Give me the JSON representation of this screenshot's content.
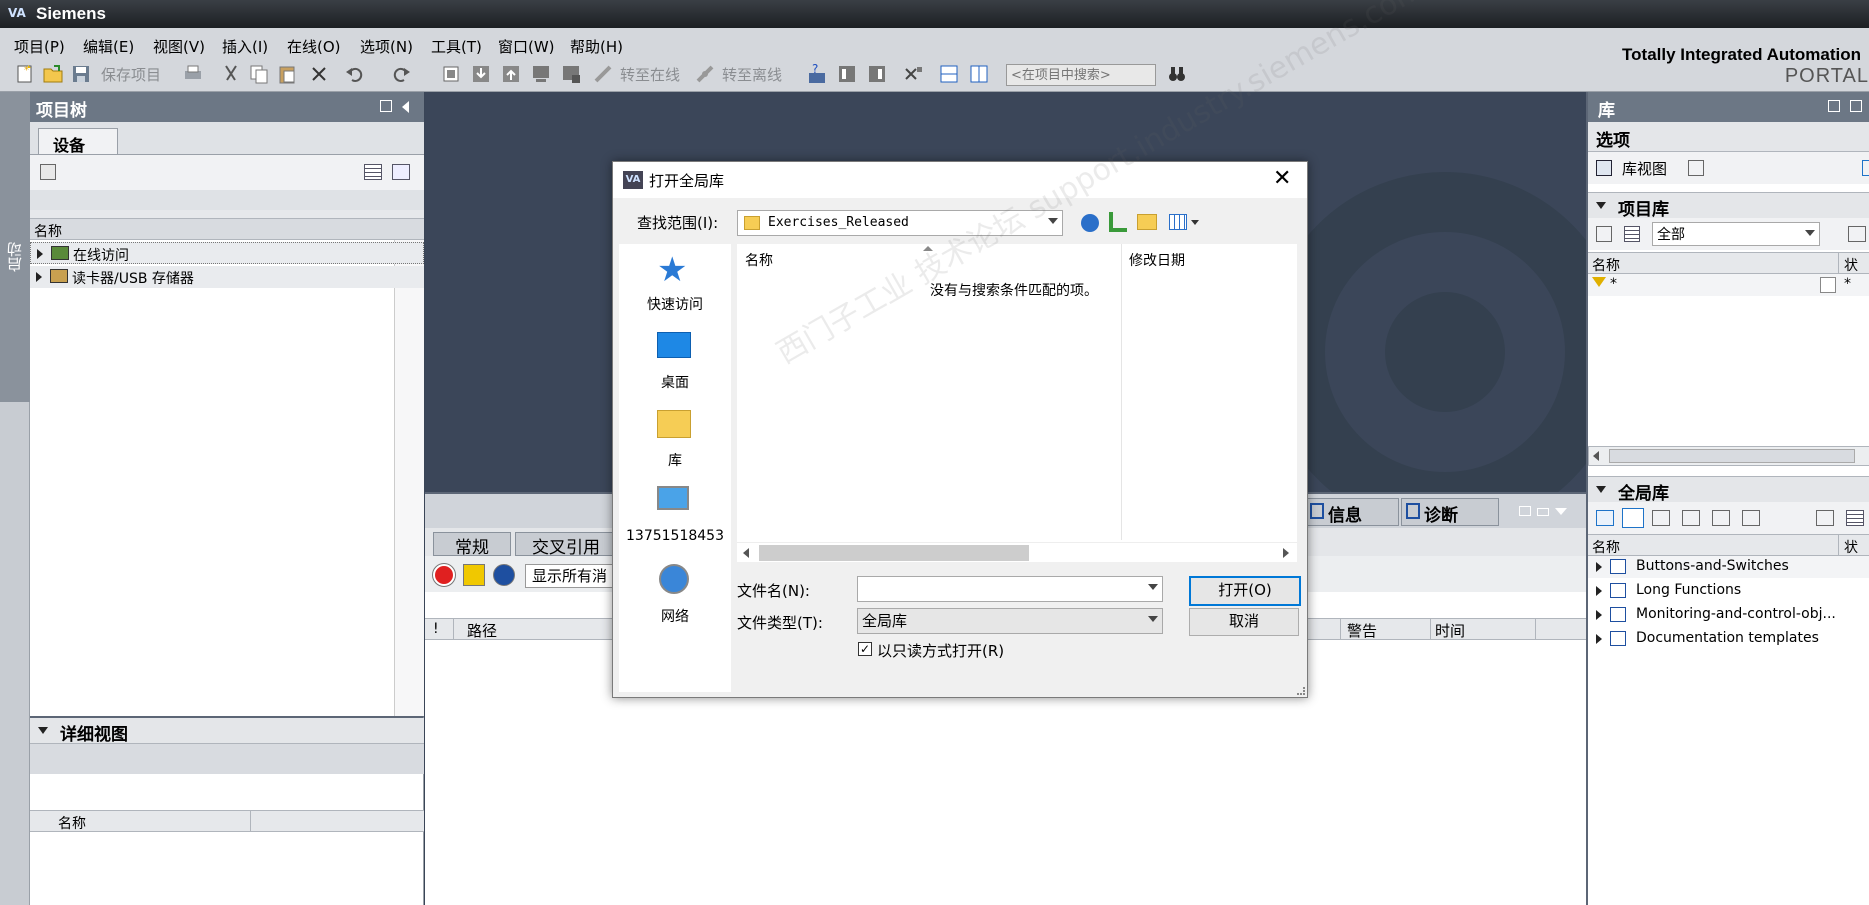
{
  "app": {
    "title": "Siemens",
    "brand_line1": "Totally Integrated Automation",
    "brand_line2": "PORTAL"
  },
  "menu": [
    "项目(P)",
    "编辑(E)",
    "视图(V)",
    "插入(I)",
    "在线(O)",
    "选项(N)",
    "工具(T)",
    "窗口(W)",
    "帮助(H)"
  ],
  "toolbar": {
    "save_project": "保存项目",
    "go_online": "转至在线",
    "go_offline": "转至离线",
    "search_placeholder": "<在项目中搜索>"
  },
  "side_strip": {
    "label": "启动"
  },
  "project_tree": {
    "title": "项目树",
    "tab": "设备",
    "column_name": "名称",
    "items": [
      {
        "label": "在线访问"
      },
      {
        "label": "读卡器/USB 存储器"
      }
    ]
  },
  "detail_view": {
    "title": "详细视图",
    "column_name": "名称"
  },
  "inspector": {
    "tabs": [
      "常规",
      "交叉引用"
    ],
    "show_all_messages": "显示所有消",
    "info_tab": "信息",
    "diag_tab": "诊断",
    "columns": [
      "!",
      "路径",
      "警告",
      "时间"
    ]
  },
  "library": {
    "title": "库",
    "options": "选项",
    "library_view": "库视图",
    "project_library": "项目库",
    "filter_value": "全部",
    "column_name": "名称",
    "column_status": "状态",
    "filter_row": "*",
    "filter_status": "*",
    "global_library": "全局库",
    "global_items": [
      "Buttons-and-Switches",
      "Long Functions",
      "Monitoring-and-control-obj...",
      "Documentation templates"
    ]
  },
  "dialog": {
    "title": "打开全局库",
    "look_in_label": "查找范围(I):",
    "look_in_value": "Exercises_Released",
    "places": [
      "快速访问",
      "桌面",
      "库",
      "13751518453",
      "网络"
    ],
    "col_name": "名称",
    "col_date": "修改日期",
    "empty_message": "没有与搜索条件匹配的项。",
    "filename_label": "文件名(N):",
    "filename_value": "",
    "filetype_label": "文件类型(T):",
    "filetype_value": "全局库",
    "readonly_label": "以只读方式打开(R)",
    "readonly_checked": true,
    "open_button": "打开(O)",
    "cancel_button": "取消",
    "watermark": "西门子工业 技术论坛 support.industry.siemens.com/cs"
  },
  "colors": {
    "dark_bg": "#3a4557",
    "panel_header": "#6c7785",
    "accent_blue": "#1e73c8"
  }
}
